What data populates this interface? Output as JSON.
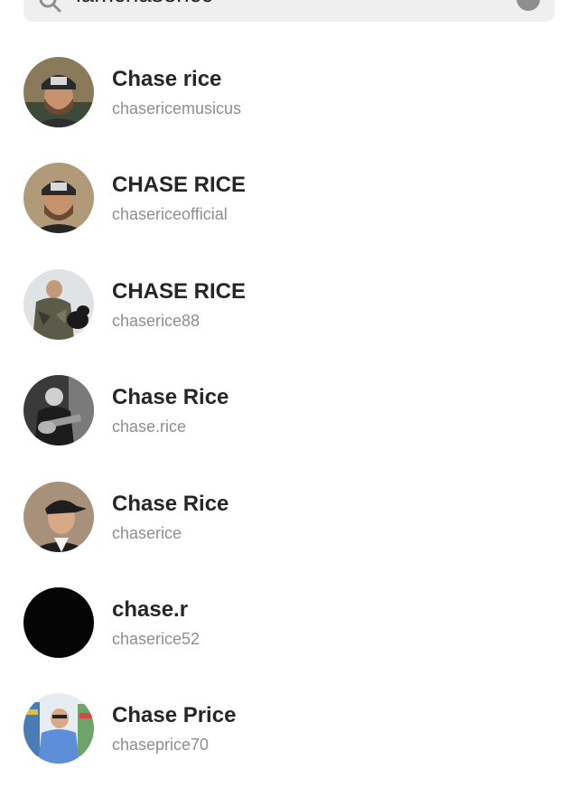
{
  "search": {
    "query": "lamchasericc"
  },
  "results": [
    {
      "name": "Chase rice",
      "handle": "chasericemusicus",
      "avatar": "man-with-cap-avatar"
    },
    {
      "name": "CHASE RICE",
      "handle": "chasericeofficial",
      "avatar": "man-with-cap-avatar"
    },
    {
      "name": "CHASE RICE",
      "handle": "chaserice88",
      "avatar": "hunter-with-dog-avatar"
    },
    {
      "name": "Chase Rice",
      "handle": "chase.rice",
      "avatar": "guitarist-bw-avatar"
    },
    {
      "name": "Chase Rice",
      "handle": "chaserice",
      "avatar": "man-backwards-cap-avatar"
    },
    {
      "name": "chase.r",
      "handle": "chaserice52",
      "avatar": "black-avatar"
    },
    {
      "name": "Chase Price",
      "handle": "chaseprice70",
      "avatar": "man-in-store-avatar"
    }
  ]
}
